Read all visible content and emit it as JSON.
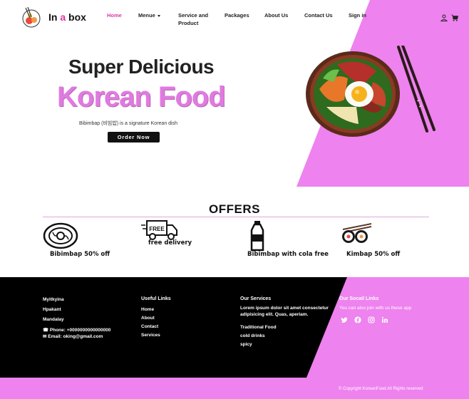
{
  "colors": {
    "accent": "#ee82ee",
    "brand_pink": "#e030a8",
    "footer_dark": "#000000"
  },
  "nav": {
    "brand_pre": "In ",
    "brand_accent": "a",
    "brand_post": " box",
    "items": [
      {
        "label": "Home"
      },
      {
        "label": "Menue"
      },
      {
        "label": "Service and Product"
      },
      {
        "label": "Packages"
      },
      {
        "label": "About Us"
      },
      {
        "label": "Contact Us"
      },
      {
        "label": "Sign in"
      }
    ],
    "icons": [
      "user-icon",
      "cart-icon"
    ]
  },
  "hero": {
    "title_line1": "Super Delicious",
    "title_line2": "Korean Food",
    "subtitle": "Bibimbap (비빔밥) is a signature Korean dish",
    "cta": "Order Now"
  },
  "offers": {
    "title": "OFFERS",
    "items": [
      {
        "label": "Bibimbap 50% off",
        "icon": "bowl-icon"
      },
      {
        "label": "free delivery",
        "badge": "FREE",
        "icon": "delivery-truck-icon"
      },
      {
        "label": "Bibimbap with cola free",
        "icon": "bottle-icon"
      },
      {
        "label": "Kimbap 50% off",
        "icon": "kimbap-icon"
      }
    ]
  },
  "footer": {
    "locations": [
      "Myitkyina",
      "Hpakant",
      "Mandalay"
    ],
    "phone": "Phone: +0000000000000000",
    "email": "Email: oking@gmail.com",
    "useful_links_title": "Useful Links",
    "useful_links": [
      "Home",
      "About",
      "Contact",
      "Services"
    ],
    "services_title": "Our Services",
    "services_text_1": "Lorem ipsum dolor sit amet consectetur",
    "services_text_2": "adipisicing elit. Quas, aperiam.",
    "services": [
      "Traditional Food",
      "cold drinks",
      "spicy"
    ],
    "social_title": "Our Socail Links",
    "social_text": "You can also join with us these app",
    "social_icons": [
      "twitter-icon",
      "facebook-icon",
      "instagram-icon",
      "linkedin-icon"
    ],
    "copyright": "© Copyright KoreanFood.All Rights reserved"
  }
}
